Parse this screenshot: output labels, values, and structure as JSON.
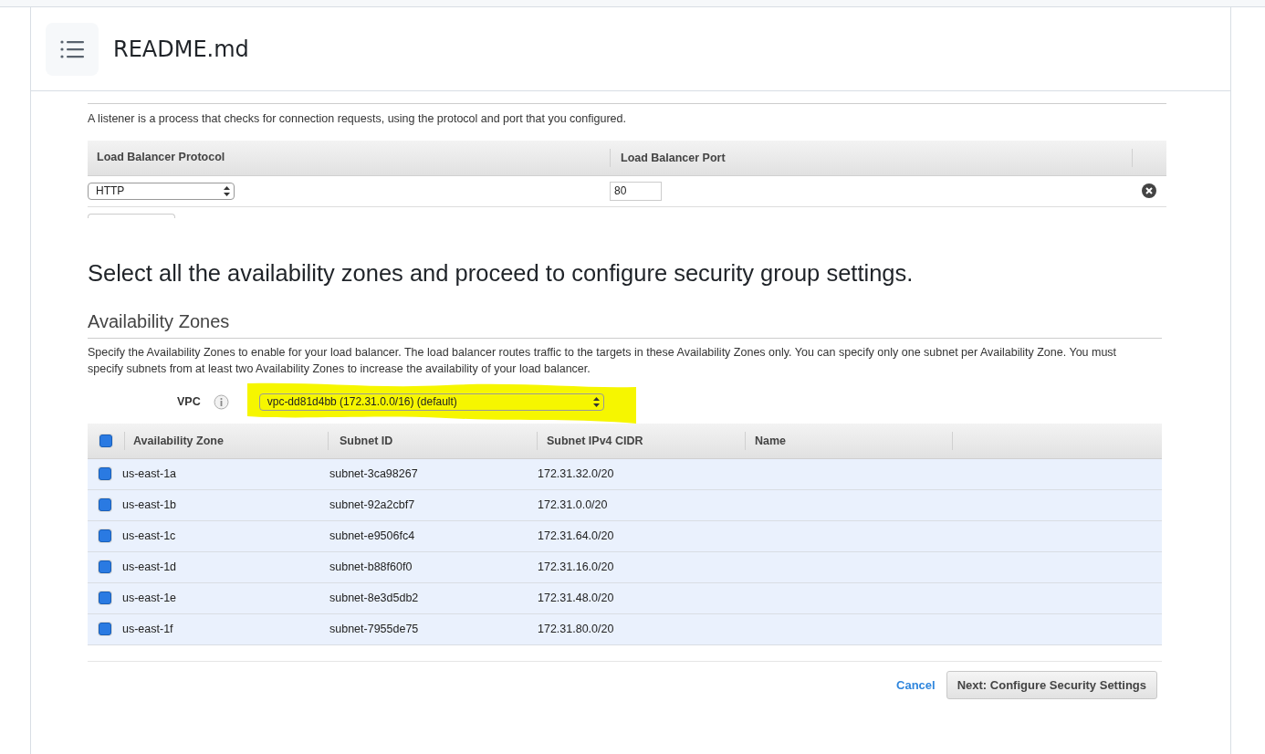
{
  "header": {
    "title": "README.md"
  },
  "listeners": {
    "description": "A listener is a process that checks for connection requests, using the protocol and port that you configured.",
    "columns": [
      "Load Balancer Protocol",
      "Load Balancer Port"
    ],
    "rows": [
      {
        "protocol": "HTTP",
        "port": "80"
      }
    ]
  },
  "instruction": "Select all the availability zones and proceed to configure security group settings.",
  "availability_zones": {
    "title": "Availability Zones",
    "description": "Specify the Availability Zones to enable for your load balancer. The load balancer routes traffic to the targets in these Availability Zones only. You can specify only one subnet per Availability Zone. You must specify subnets from at least two Availability Zones to increase the availability of your load balancer.",
    "vpc": {
      "label": "VPC",
      "value": "vpc-dd81d4bb (172.31.0.0/16) (default)"
    },
    "select_all": {
      "checked": true
    },
    "columns": [
      "Availability Zone",
      "Subnet ID",
      "Subnet IPv4 CIDR",
      "Name"
    ],
    "rows": [
      {
        "zone": "us-east-1a",
        "subnet_id": "subnet-3ca98267",
        "cidr": "172.31.32.0/20",
        "checked": true
      },
      {
        "zone": "us-east-1b",
        "subnet_id": "subnet-92a2cbf7",
        "cidr": "172.31.0.0/20",
        "checked": true
      },
      {
        "zone": "us-east-1c",
        "subnet_id": "subnet-e9506fc4",
        "cidr": "172.31.64.0/20",
        "checked": true
      },
      {
        "zone": "us-east-1d",
        "subnet_id": "subnet-b88f60f0",
        "cidr": "172.31.16.0/20",
        "checked": true
      },
      {
        "zone": "us-east-1e",
        "subnet_id": "subnet-8e3d5db2",
        "cidr": "172.31.48.0/20",
        "checked": true
      },
      {
        "zone": "us-east-1f",
        "subnet_id": "subnet-7955de75",
        "cidr": "172.31.80.0/20",
        "checked": true
      }
    ]
  },
  "actions": {
    "cancel": "Cancel",
    "next": "Next: Configure Security Settings"
  }
}
